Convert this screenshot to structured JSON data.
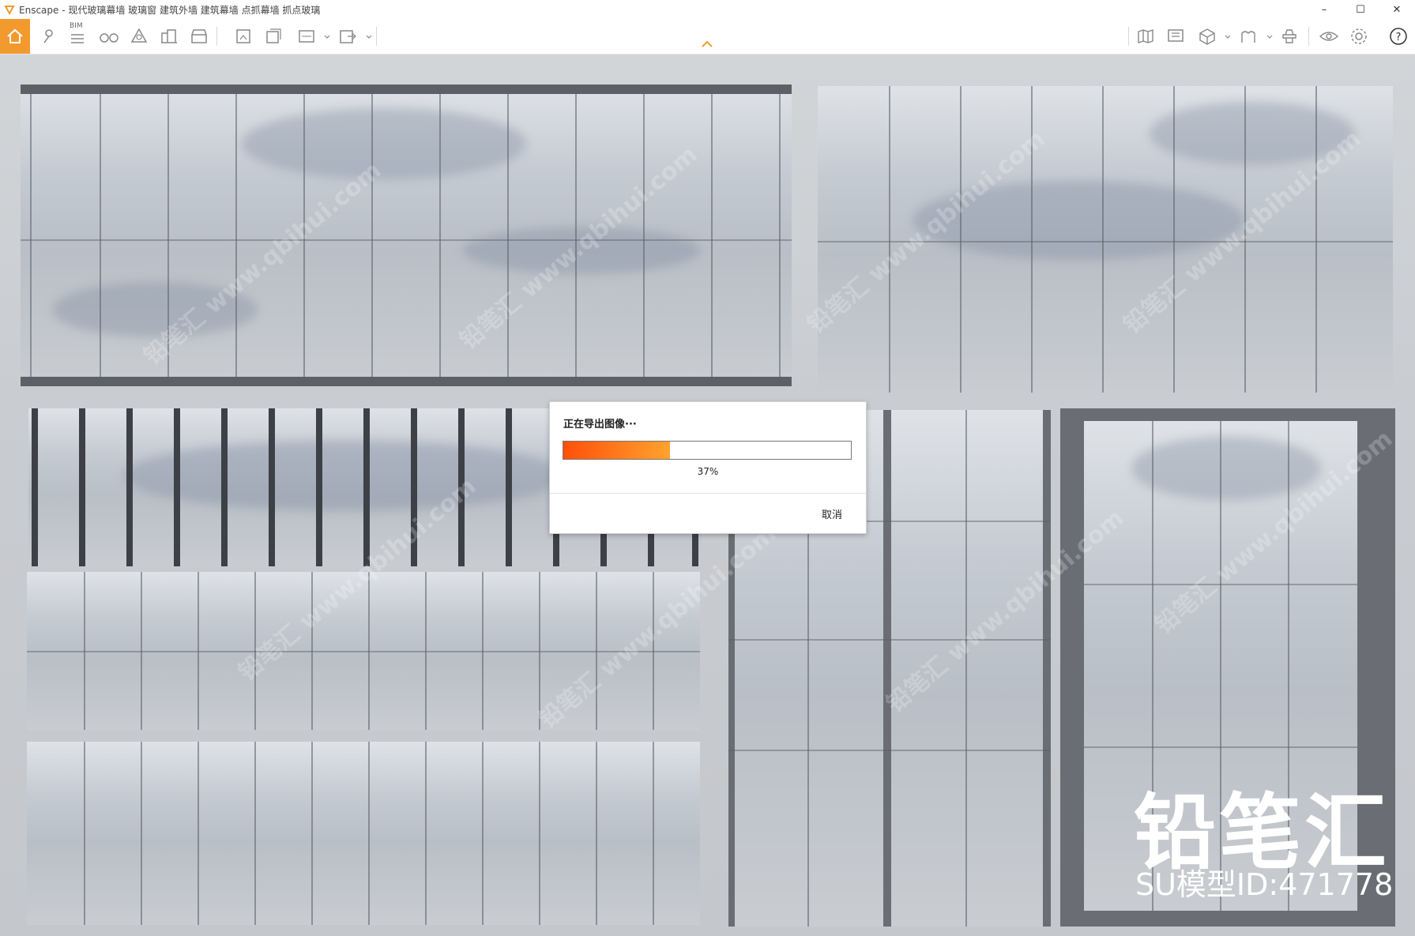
{
  "window": {
    "title": "Enscape - 现代玻璃幕墙 玻璃窗 建筑外墙 建筑幕墙 点抓幕墙 抓点玻璃",
    "controls": {
      "minimize": "–",
      "maximize": "☐",
      "close": "✕"
    }
  },
  "toolbar": {
    "bim_label": "BIM",
    "accent_color": "#f39a2e",
    "left_icons": [
      "home-icon",
      "map-pin-icon",
      "bim-list-icon",
      "binoculars-icon",
      "asset-library-icon",
      "buildings-icon",
      "clapboard-icon",
      "render-image-icon",
      "batch-render-icon",
      "panorama-360-icon",
      "export-exe-icon"
    ],
    "right_icons": [
      "map-icon",
      "billboard-icon",
      "cube-icon",
      "atlas-icon",
      "settings-hat-icon",
      "visibility-eye-icon",
      "gear-icon",
      "help-icon"
    ]
  },
  "viewport": {
    "watermark_text": "铅笔汇 www.qbihui.com",
    "brand_cn": "铅笔汇",
    "brand_id": "SU模型ID:471778"
  },
  "export_dialog": {
    "title": "正在导出图像···",
    "progress": 0.37,
    "progress_text": "37%",
    "cancel_label": "取消",
    "progress_colors": [
      "#ff4f0a",
      "#ffa32e"
    ]
  }
}
